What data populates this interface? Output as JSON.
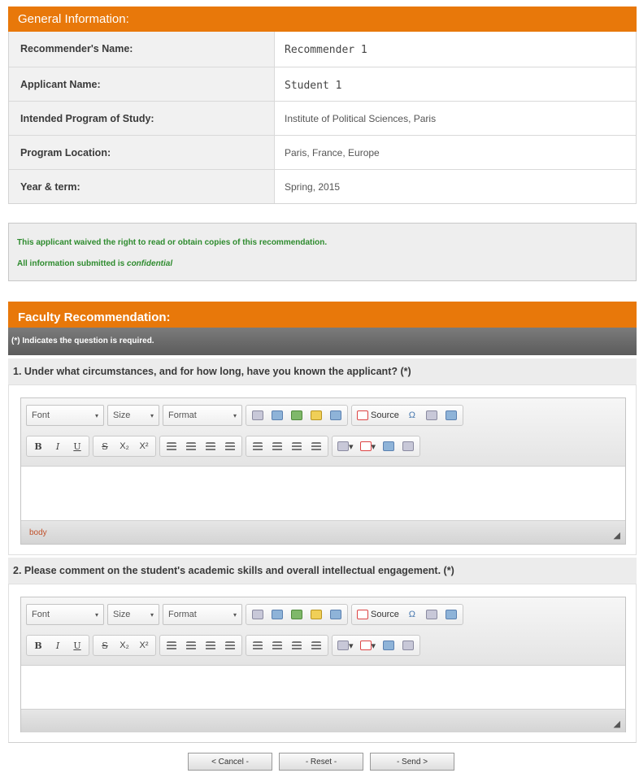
{
  "general": {
    "title": "General Information:",
    "rows": [
      {
        "label": "Recommender's Name:",
        "value": "Recommender 1"
      },
      {
        "label": "Applicant Name:",
        "value": "Student 1"
      },
      {
        "label": "Intended Program of Study:",
        "value": "Institute of Political Sciences, Paris"
      },
      {
        "label": "Program Location:",
        "value": "Paris, France, Europe"
      },
      {
        "label": "Year & term:",
        "value": "Spring, 2015"
      }
    ]
  },
  "waiver": {
    "line1": "This applicant waived the right to read or obtain copies of this recommendation.",
    "line2_prefix": "All information submitted is ",
    "line2_emph": "confidential"
  },
  "faculty": {
    "title": "Faculty Recommendation:",
    "required_note": "(*) Indicates the question is required.",
    "questions": [
      {
        "text": "1. Under what circumstances, and for how long, have you known the applicant?  (*)"
      },
      {
        "text": "2. Please comment on the student's academic skills and overall intellectual engagement.  (*)"
      }
    ]
  },
  "editor": {
    "font_label": "Font",
    "size_label": "Size",
    "format_label": "Format",
    "source_label": "Source",
    "bold": "B",
    "italic": "I",
    "underline": "U",
    "strike": "S",
    "subscript": "X₂",
    "superscript": "X²",
    "status_path": "body"
  },
  "actions": {
    "cancel": "< Cancel -",
    "reset": "- Reset -",
    "send": "- Send >"
  },
  "colors": {
    "header_orange": "#e8780a",
    "required_bar": "#666666",
    "waiver_green": "#2e8b2e"
  }
}
